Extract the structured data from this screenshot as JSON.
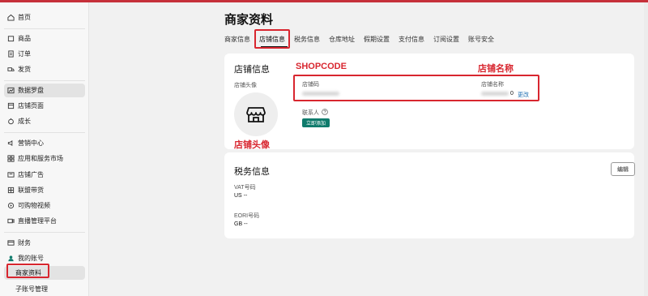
{
  "sidebar": {
    "items": [
      {
        "label": "首页",
        "icon": "home-icon"
      },
      {
        "label": "商品",
        "icon": "product-icon"
      },
      {
        "label": "订单",
        "icon": "order-icon"
      },
      {
        "label": "发货",
        "icon": "shipping-icon"
      },
      {
        "label": "数据罗盘",
        "icon": "compass-icon"
      },
      {
        "label": "店铺页面",
        "icon": "store-page-icon"
      },
      {
        "label": "成长",
        "icon": "growth-icon"
      },
      {
        "label": "营销中心",
        "icon": "marketing-icon"
      },
      {
        "label": "应用和服务市场",
        "icon": "apps-icon"
      },
      {
        "label": "店铺广告",
        "icon": "ads-icon"
      },
      {
        "label": "联盟带货",
        "icon": "affiliate-icon"
      },
      {
        "label": "可购物视频",
        "icon": "video-icon"
      },
      {
        "label": "直播管理平台",
        "icon": "live-icon"
      },
      {
        "label": "财务",
        "icon": "finance-icon"
      },
      {
        "label": "我的账号",
        "icon": "account-icon"
      },
      {
        "label": "商家资料"
      },
      {
        "label": "子账号管理"
      }
    ]
  },
  "header": {
    "title": "商家资料"
  },
  "tabs": [
    "商家信息",
    "店铺信息",
    "税务信息",
    "仓库地址",
    "假期设置",
    "支付信息",
    "订阅设置",
    "账号安全"
  ],
  "store_card": {
    "title": "店铺信息",
    "avatar_label": "店铺头像",
    "shop_code_label": "店铺码",
    "shop_name_label": "店铺名称",
    "shop_name_suffix": "0",
    "change_link": "更改",
    "contact_label": "联系人",
    "contact_button": "立即添加"
  },
  "annotations": {
    "shopcode": "SHOPCODE",
    "shop_name": "店铺名称",
    "avatar": "店铺头像"
  },
  "tax_card": {
    "title": "税务信息",
    "edit_button": "编辑",
    "vat_label": "VAT号码",
    "vat_value": "US  --",
    "eori_label": "EORI号码",
    "eori_value": "GB  --"
  },
  "colors": {
    "accent": "#d8262f",
    "brand": "#0f7b6c",
    "link": "#1f6fb2"
  }
}
